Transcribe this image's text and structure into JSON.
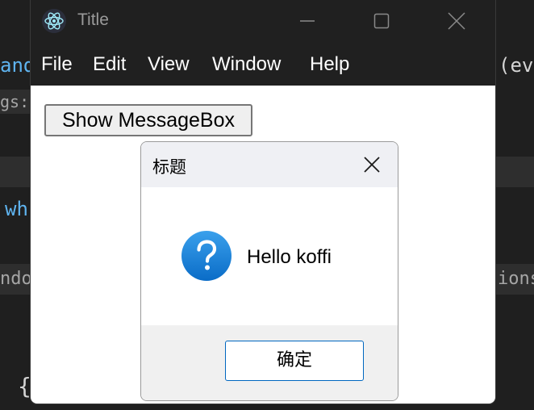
{
  "app": {
    "title": "Title",
    "menu": [
      "File",
      "Edit",
      "View",
      "Window",
      "Help"
    ],
    "show_button_label": "Show MessageBox"
  },
  "dialog": {
    "title": "标题",
    "message": "Hello koffi",
    "ok_label": "确定",
    "icon": "question-icon",
    "accent_color": "#0067c0"
  },
  "background_code": {
    "fragments": [
      "and",
      "gs:",
      "wh",
      "ndo",
      "{",
      "(ev",
      "ions:"
    ]
  }
}
